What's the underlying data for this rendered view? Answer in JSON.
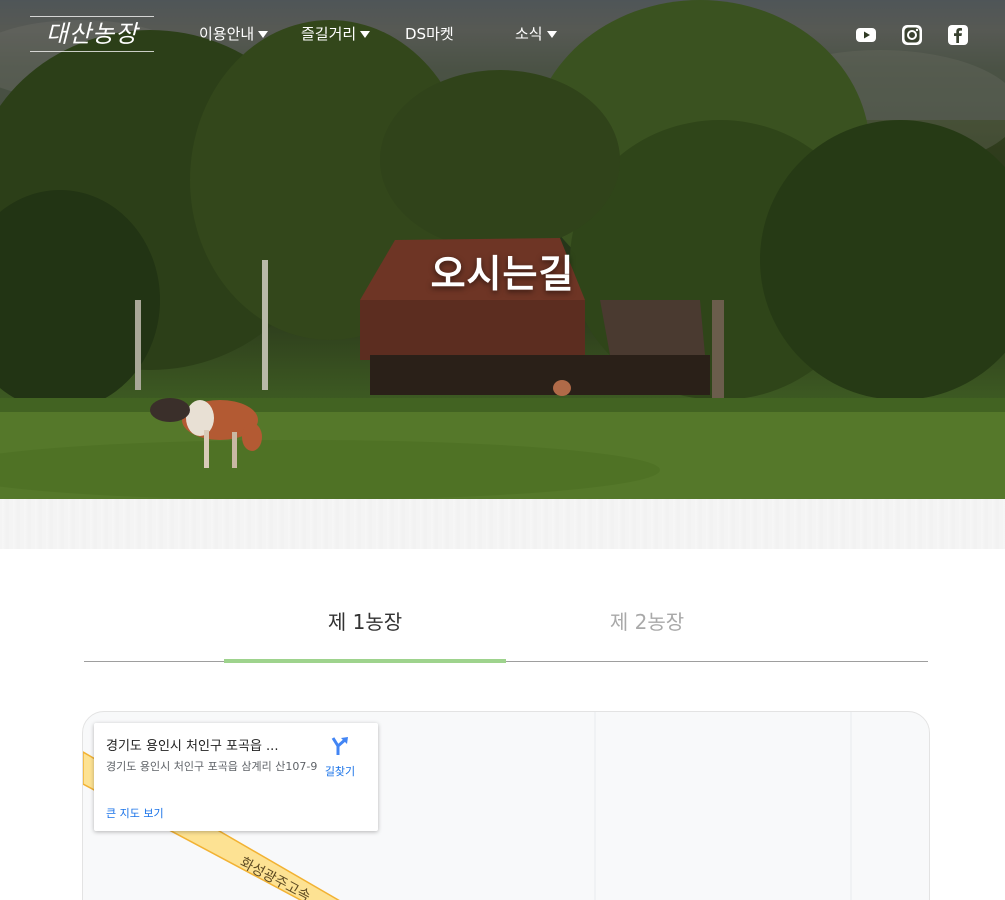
{
  "nav": {
    "logo": "대산농장",
    "menu": [
      {
        "label": "이용안내",
        "has_dropdown": true
      },
      {
        "label": "즐길거리",
        "has_dropdown": true
      },
      {
        "label": "DS마켓",
        "has_dropdown": false
      },
      {
        "label": "소식",
        "has_dropdown": true
      }
    ],
    "social": [
      "youtube-icon",
      "instagram-icon",
      "facebook-icon"
    ]
  },
  "hero": {
    "title": "오시는길"
  },
  "tabs": [
    {
      "label": "제 1농장",
      "active": true
    },
    {
      "label": "제 2농장",
      "active": false
    }
  ],
  "map": {
    "card": {
      "title": "경기도 용인시 처인구 포곡읍 ...",
      "address": "경기도 용인시 처인구 포곡읍 삼계리 산107-9",
      "directions": "길찾기",
      "larger_map": "큰 지도 보기"
    },
    "road_label": "화성광주고속"
  },
  "colors": {
    "tab_active_underline": "#9ed38d",
    "link_blue": "#1a73e8",
    "road_yellow": "#fde293"
  }
}
